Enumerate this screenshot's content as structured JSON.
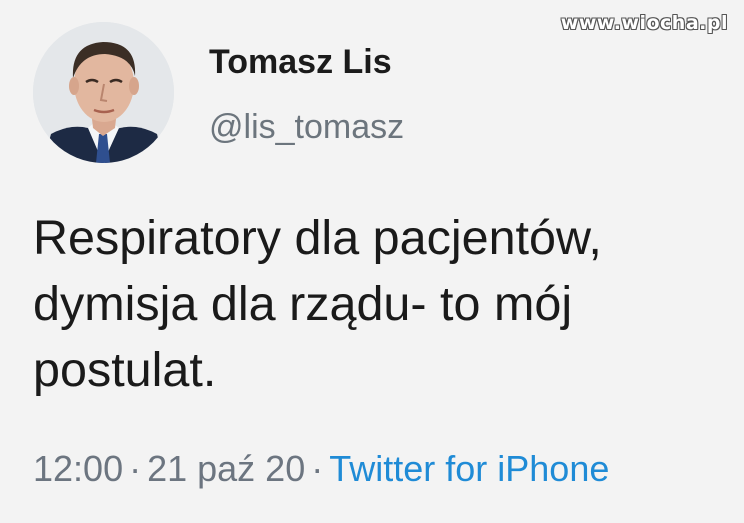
{
  "watermark": "www.wiocha.pl",
  "tweet": {
    "author": {
      "display_name": "Tomasz Lis",
      "handle": "@lis_tomasz"
    },
    "text_lines": [
      "Respiratory dla pacjentów,",
      "dymisja dla rządu- to mój",
      "postulat."
    ],
    "time": "12:00",
    "date": "21 paź 20",
    "separator": "·",
    "source": "Twitter for iPhone"
  },
  "colors": {
    "background": "#f3f3f3",
    "text": "#1a1a1a",
    "muted": "#6c7580",
    "link": "#1f8bd6"
  }
}
